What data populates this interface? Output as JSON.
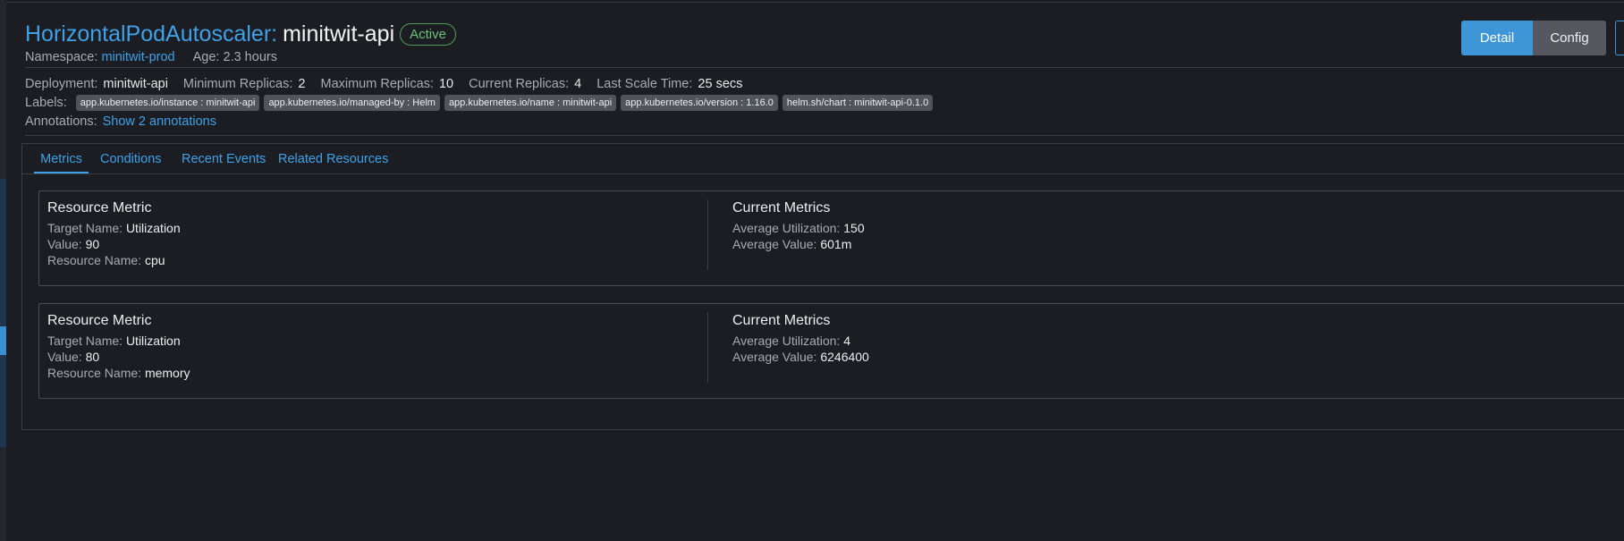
{
  "header": {
    "kind": "HorizontalPodAutoscaler:",
    "name": "minitwit-api",
    "status": "Active",
    "namespace_label": "Namespace:",
    "namespace": "minitwit-prod",
    "age_label": "Age:",
    "age": "2.3 hours"
  },
  "buttons": {
    "detail": "Detail",
    "config": "Config"
  },
  "details": {
    "deployment_label": "Deployment:",
    "deployment": "minitwit-api",
    "min_label": "Minimum Replicas:",
    "min": "2",
    "max_label": "Maximum Replicas:",
    "max": "10",
    "current_label": "Current Replicas:",
    "current": "4",
    "last_scale_label": "Last Scale Time:",
    "last_scale": "25 secs"
  },
  "labels": {
    "title": "Labels:",
    "items": [
      "app.kubernetes.io/instance : minitwit-api",
      "app.kubernetes.io/managed-by : Helm",
      "app.kubernetes.io/name : minitwit-api",
      "app.kubernetes.io/version : 1.16.0",
      "helm.sh/chart : minitwit-api-0.1.0"
    ]
  },
  "annotations": {
    "title": "Annotations:",
    "link": "Show 2 annotations"
  },
  "tabs": [
    {
      "label": "Metrics"
    },
    {
      "label": "Conditions"
    },
    {
      "label": "Recent Events"
    },
    {
      "label": "Related Resources"
    }
  ],
  "metrics": [
    {
      "heading": "Resource Metric",
      "target_name_label": "Target Name:",
      "target_name": "Utilization",
      "value_label": "Value:",
      "value": "90",
      "resource_name_label": "Resource Name:",
      "resource_name": "cpu",
      "current_heading": "Current Metrics",
      "avg_util_label": "Average Utilization:",
      "avg_util": "150",
      "avg_value_label": "Average Value:",
      "avg_value": "601m"
    },
    {
      "heading": "Resource Metric",
      "target_name_label": "Target Name:",
      "target_name": "Utilization",
      "value_label": "Value:",
      "value": "80",
      "resource_name_label": "Resource Name:",
      "resource_name": "memory",
      "current_heading": "Current Metrics",
      "avg_util_label": "Average Utilization:",
      "avg_util": "4",
      "avg_value_label": "Average Value:",
      "avg_value": "6246400"
    }
  ],
  "colors": {
    "accent": "#3e95d8",
    "status_green": "#6cc274",
    "background": "#1b1d22"
  }
}
